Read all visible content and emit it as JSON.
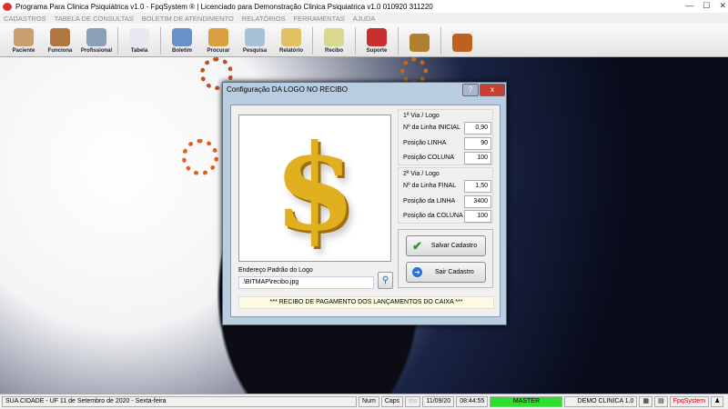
{
  "window": {
    "title": "Programa Para Clinica Psiquiátrica v1.0 - FpqSystem ® | Licenciado para  Demonstração Clinica Psiquiatrica v1.0 010920 311220"
  },
  "menu": [
    "CADASTROS",
    "TABELA DE CONSULTAS",
    "BOLETIM DE ATENDIMENTO",
    "RELATÓRIOS",
    "FERRAMENTAS",
    "AJUDA"
  ],
  "toolbar": [
    {
      "label": "Paciente",
      "color": "#c9a070"
    },
    {
      "label": "Funciona",
      "color": "#b07840"
    },
    {
      "label": "Profissional",
      "color": "#8aa0b8"
    },
    {
      "label": "Tabela",
      "color": "#e8e8f0"
    },
    {
      "label": "Boletim",
      "color": "#6a90c8"
    },
    {
      "label": "Procurar",
      "color": "#d8a040"
    },
    {
      "label": "Pesquisa",
      "color": "#a8c0d8"
    },
    {
      "label": "Relatório",
      "color": "#e0c060"
    },
    {
      "label": "Recibo",
      "color": "#d8d890"
    },
    {
      "label": "Suporte",
      "color": "#c83030"
    },
    {
      "label": "",
      "color": "#b08030"
    },
    {
      "label": "",
      "color": "#c06020"
    }
  ],
  "dialog": {
    "title": "Configuração DA LOGO NO RECIBO",
    "help": "?",
    "close": "x",
    "group1": {
      "title": "1ª Via / Logo",
      "fields": [
        {
          "label": "Nº da Linha INICIAL",
          "value": "0,90"
        },
        {
          "label": "Posição LINHA",
          "value": "90"
        },
        {
          "label": "Posição COLUNA",
          "value": "100"
        }
      ]
    },
    "group2": {
      "title": "2ª Via / Logo",
      "fields": [
        {
          "label": "Nº da Linha FINAL",
          "value": "1,50"
        },
        {
          "label": "Posição da LINHA",
          "value": "3400"
        },
        {
          "label": "Posição da COLUNA",
          "value": "100"
        }
      ]
    },
    "save_label": "Salvar Cadastro",
    "exit_label": "Sair Cadastro",
    "path_label": "Endereço Padrão do Logo",
    "path_value": ".\\BITMAP\\recibo.jpg",
    "logo_symbol": "$",
    "footer": "*** RECIBO DE PAGAMENTO DOS LANÇAMENTOS DO CAIXA ***"
  },
  "status": {
    "city": "SUA CIDADE - UF 11 de Setembro de 2020 - Sexta-feira",
    "num": "Num",
    "caps": "Caps",
    "ins": "Ins",
    "date": "11/09/20",
    "time": "08:44:55",
    "user": "MASTER",
    "company": "DEMO CLINICA 1.0",
    "brand": "FpqSystem"
  }
}
